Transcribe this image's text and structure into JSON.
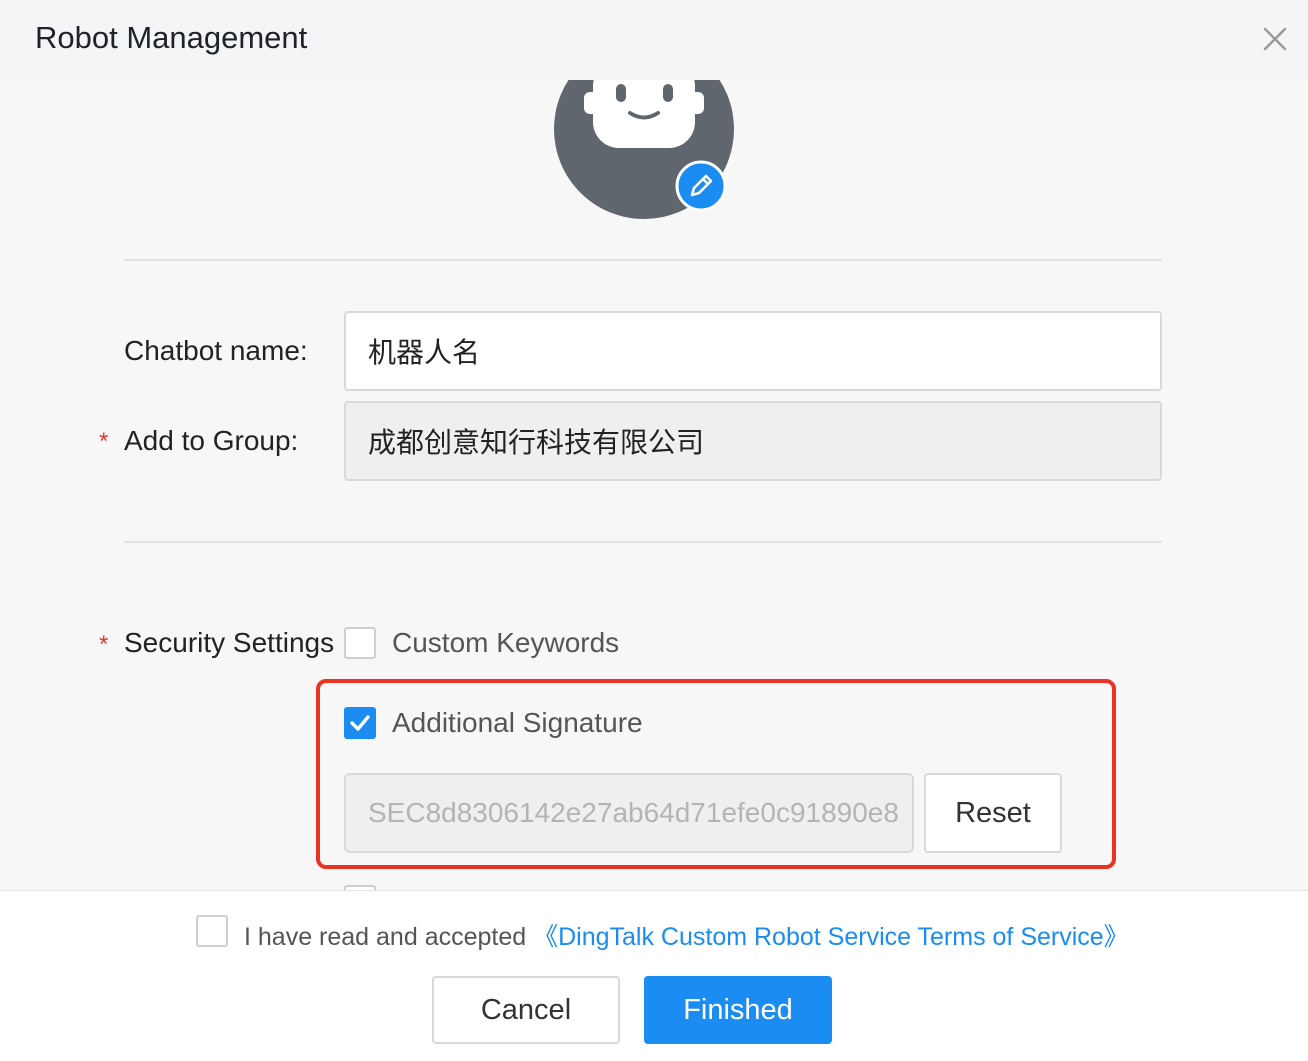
{
  "header": {
    "title": "Robot Management"
  },
  "form": {
    "chatbot_name_label": "Chatbot name:",
    "chatbot_name_value": "机器人名",
    "add_to_group_label": "Add to Group:",
    "add_to_group_value": "成都创意知行科技有限公司",
    "required_mark": "*",
    "security_label": "Security Settings",
    "options": {
      "custom_keywords": {
        "label": "Custom Keywords",
        "checked": false
      },
      "additional_signature": {
        "label": "Additional Signature",
        "checked": true
      }
    },
    "secret_value": "SEC8d8306142e27ab64d71efe0c91890e8",
    "reset_label": "Reset"
  },
  "footer": {
    "terms_prefix": "I have read and accepted ",
    "terms_link": "《DingTalk Custom Robot Service Terms of Service》",
    "cancel_label": "Cancel",
    "finished_label": "Finished"
  },
  "colors": {
    "primary": "#1a8cf2",
    "highlight_border": "#ea3323",
    "avatar_bg": "#5f666d"
  },
  "icons": [
    "close-icon",
    "robot-avatar-icon",
    "pencil-edit-icon",
    "checkmark-icon"
  ]
}
